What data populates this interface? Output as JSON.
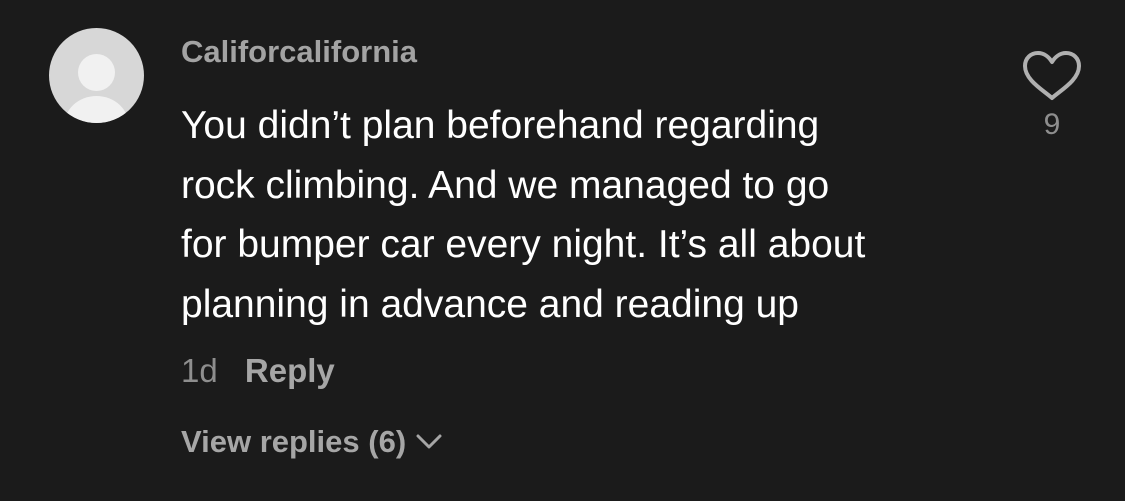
{
  "comment": {
    "username": "Califorcalifornia",
    "text_lines": [
      "You didn’t plan beforehand regarding",
      "rock climbing. And we managed to go",
      "for bumper car every night. It’s all about",
      "planning in advance and reading up"
    ],
    "timestamp": "1d",
    "reply_label": "Reply",
    "view_replies_label": "View replies (6)",
    "like_count": "9"
  },
  "icons": {
    "avatar": "default-avatar-icon",
    "like": "heart-icon",
    "expand": "chevron-down-icon"
  },
  "colors": {
    "background": "#1b1b1b",
    "username": "#a3a3a3",
    "text": "#ffffff",
    "secondary": "#8e8e8e"
  }
}
